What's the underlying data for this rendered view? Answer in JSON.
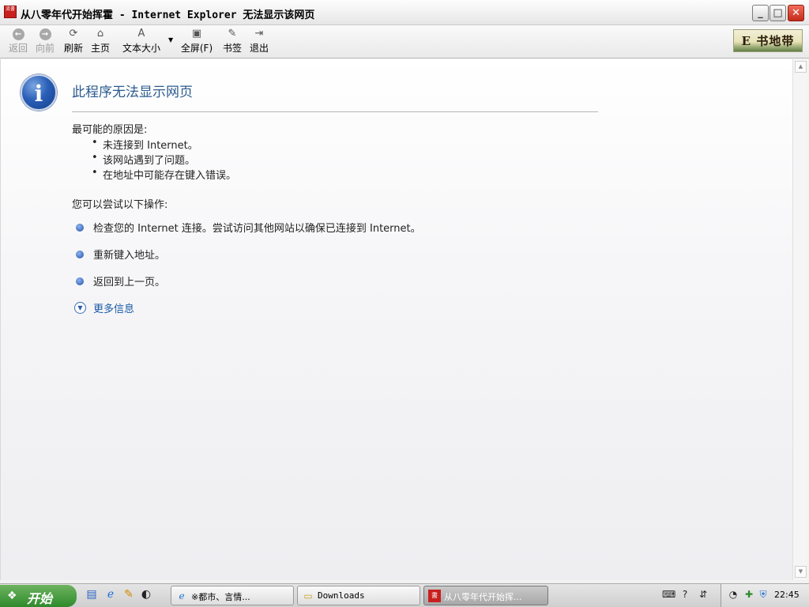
{
  "window": {
    "title": "从八零年代开始挥霍 - Internet Explorer 无法显示该网页",
    "logo_text": "流書",
    "controls": {
      "minimize": "_",
      "maximize": "□",
      "close": "✕"
    }
  },
  "toolbar": {
    "back": {
      "label": "返回",
      "icon": "back-arrow-icon"
    },
    "forward": {
      "label": "向前",
      "icon": "forward-arrow-icon"
    },
    "refresh": {
      "label": "刷新",
      "icon": "refresh-icon"
    },
    "home": {
      "label": "主页",
      "icon": "home-icon"
    },
    "text_size": {
      "label": "文本大小",
      "icon": "text-size-icon"
    },
    "fullscreen": {
      "label": "全屏(F)",
      "icon": "fullscreen-icon"
    },
    "bookmark": {
      "label": "书签",
      "icon": "bookmark-icon"
    },
    "exit": {
      "label": "退出",
      "icon": "exit-icon"
    },
    "brand_text": "E 书地带"
  },
  "error_page": {
    "title": "此程序无法显示网页",
    "reasons_heading": "最可能的原因是:",
    "reasons": [
      "未连接到 Internet。",
      "该网站遇到了问题。",
      "在地址中可能存在键入错误。"
    ],
    "try_heading": "您可以尝试以下操作:",
    "actions": [
      "检查您的 Internet 连接。尝试访问其他网站以确保已连接到 Internet。",
      "重新键入地址。",
      "返回到上一页。"
    ],
    "more_info": "更多信息"
  },
  "taskbar": {
    "start_label": "开始",
    "tasks": [
      {
        "label": "※都市、言情...",
        "icon": "ie-icon"
      },
      {
        "label": "Downloads",
        "icon": "folder-icon"
      },
      {
        "label": "从八零年代开始挥...",
        "icon": "ebook-icon"
      }
    ],
    "clock": "22:45"
  },
  "colors": {
    "link_blue": "#1a5aa6",
    "title_blue": "#2c5b8e",
    "start_green": "#3c9a36",
    "close_red": "#d8412f"
  }
}
